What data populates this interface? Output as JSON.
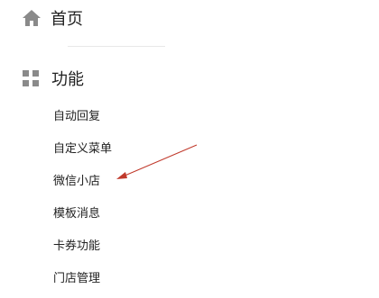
{
  "nav": {
    "home": {
      "label": "首页",
      "icon": "home-icon"
    },
    "features": {
      "label": "功能",
      "icon": "grid-icon",
      "items": [
        {
          "label": "自动回复"
        },
        {
          "label": "自定义菜单"
        },
        {
          "label": "微信小店"
        },
        {
          "label": "模板消息"
        },
        {
          "label": "卡券功能"
        },
        {
          "label": "门店管理"
        }
      ]
    }
  },
  "annotation": {
    "color": "#c0392b",
    "target": "微信小店"
  },
  "colors": {
    "icon": "#8a8a8a",
    "text": "#222222",
    "divider": "#e8e8e8"
  }
}
